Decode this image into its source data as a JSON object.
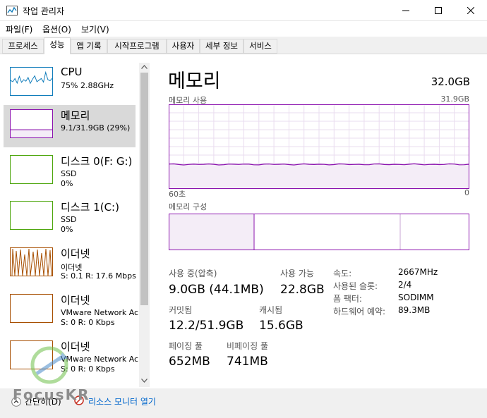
{
  "window": {
    "title": "작업 관리자"
  },
  "menu": [
    {
      "label": "파일(F)"
    },
    {
      "label": "옵션(O)"
    },
    {
      "label": "보기(V)"
    }
  ],
  "tabs": [
    {
      "label": "프로세스"
    },
    {
      "label": "성능",
      "active": true
    },
    {
      "label": "앱 기록"
    },
    {
      "label": "시작프로그램"
    },
    {
      "label": "사용자"
    },
    {
      "label": "세부 정보"
    },
    {
      "label": "서비스"
    }
  ],
  "resources": [
    {
      "name": "CPU",
      "sub": "75% 2.88GHz",
      "color": "#117dbb"
    },
    {
      "name": "메모리",
      "sub": "9.1/31.9GB (29%)",
      "color": "#8b12ae",
      "selected": true
    },
    {
      "name": "디스크 0(F: G:)",
      "sub": "SSD",
      "sub2": "0%",
      "color": "#4da60c"
    },
    {
      "name": "디스크 1(C:)",
      "sub": "SSD",
      "sub2": "0%",
      "color": "#4da60c"
    },
    {
      "name": "이더넷",
      "sub": "이더넷",
      "sub2": "S: 0.1  R: 17.6 Mbps",
      "color": "#a74f01"
    },
    {
      "name": "이더넷",
      "sub": "VMware Network Ac",
      "sub2": "S: 0  R: 0 Kbps",
      "color": "#a74f01"
    },
    {
      "name": "이더넷",
      "sub": "VMware Network Ac",
      "sub2": "S: 0  R: 0 Kbps",
      "color": "#a74f01"
    }
  ],
  "memory": {
    "title": "메모리",
    "total": "32.0GB",
    "usage_label": "메모리 사용",
    "usage_max": "31.9GB",
    "time_left": "60초",
    "time_right": "0",
    "usage_fraction": 0.29,
    "composition_label": "메모리 구성",
    "composition": {
      "in_use_fraction": 0.285,
      "standby_end_fraction": 0.77
    },
    "stats": {
      "in_use_label": "사용 중(압축)",
      "in_use_value": "9.0GB (44.1MB)",
      "available_label": "사용 가능",
      "available_value": "22.8GB",
      "committed_label": "커밋됨",
      "committed_value": "12.2/51.9GB",
      "cached_label": "캐시됨",
      "cached_value": "15.6GB",
      "paged_label": "페이징 풀",
      "paged_value": "652MB",
      "nonpaged_label": "비페이징 풀",
      "nonpaged_value": "741MB"
    },
    "details": [
      {
        "label": "속도:",
        "value": "2667MHz"
      },
      {
        "label": "사용된 슬롯:",
        "value": "2/4"
      },
      {
        "label": "폼 팩터:",
        "value": "SODIMM"
      },
      {
        "label": "하드웨어 예약:",
        "value": "89.3MB"
      }
    ]
  },
  "footer": {
    "fewer_details": "간단히(D)",
    "resource_monitor": "리소스 모니터 열기"
  },
  "watermark": {
    "text": "FocusKR"
  },
  "cpu_spark": [
    0.55,
    0.5,
    0.62,
    0.45,
    0.7,
    0.48,
    0.58,
    0.52,
    0.66,
    0.44,
    0.6,
    0.72,
    0.5,
    0.56,
    0.62,
    0.49,
    0.85,
    0.58,
    0.54,
    0.63
  ]
}
